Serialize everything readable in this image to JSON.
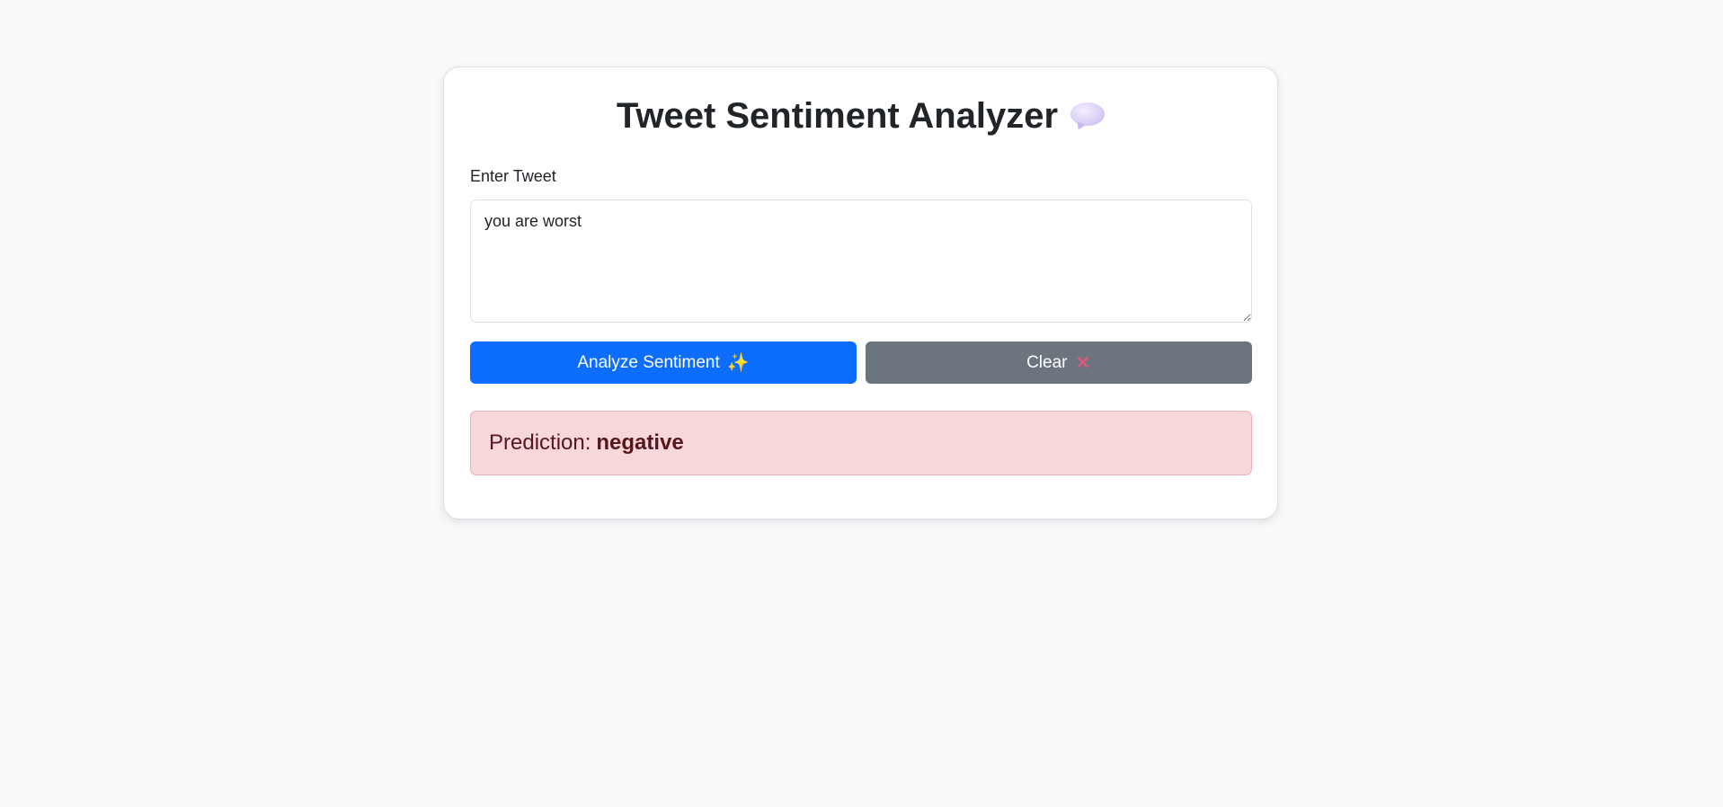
{
  "card": {
    "title": "Tweet Sentiment Analyzer",
    "title_icon": "speech-balloon-icon"
  },
  "form": {
    "label": "Enter Tweet",
    "tweet_value": "you are worst",
    "analyze_label": "Analyze Sentiment",
    "analyze_icon": "sparkles-icon",
    "clear_label": "Clear",
    "clear_icon": "cross-mark-icon"
  },
  "result": {
    "prefix": "Prediction:",
    "value": "negative"
  },
  "colors": {
    "primary": "#0d6efd",
    "secondary": "#6c757d",
    "alert_bg": "#f8d7da",
    "alert_text": "#58151c"
  }
}
